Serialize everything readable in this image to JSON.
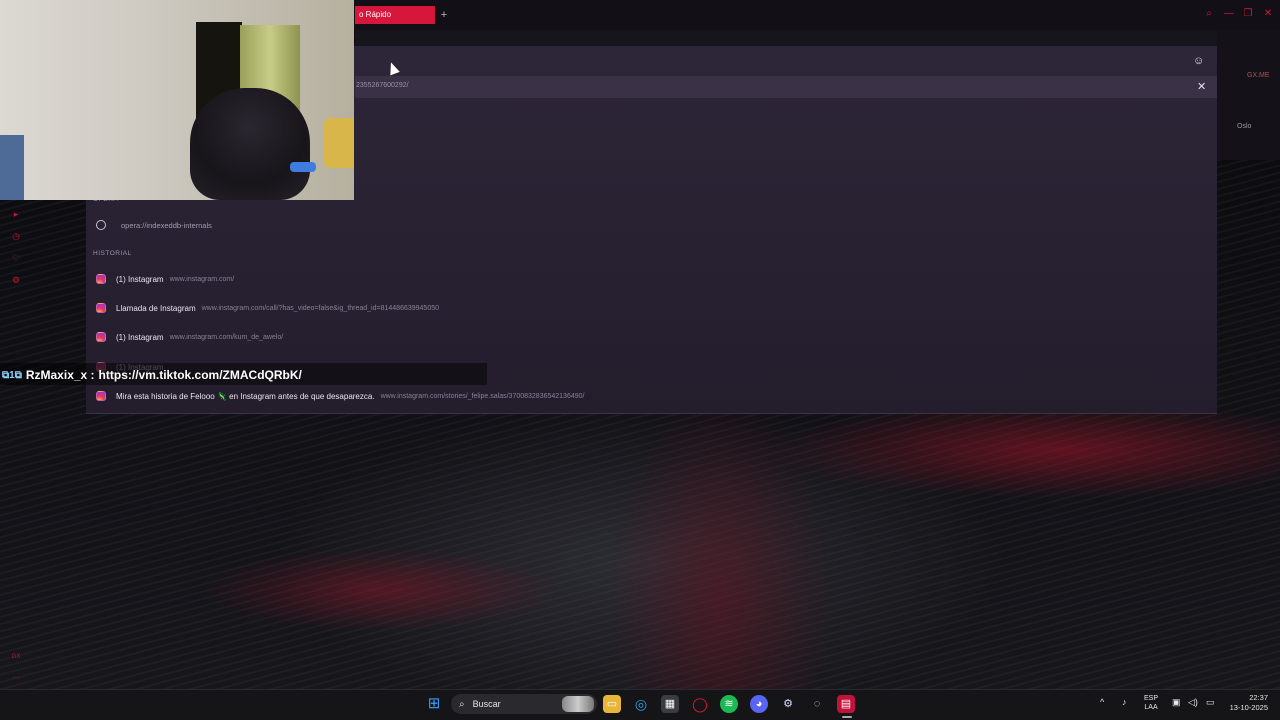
{
  "browser": {
    "active_tab_label": "o Rápido",
    "new_tab_glyph": "+",
    "window_controls": [
      "⌕",
      "—",
      "❐",
      "✕"
    ],
    "toolbar_icons": [
      "download-icon",
      "menu-icon",
      "wallet-icon"
    ],
    "right_sidebar_labels": [
      "GX.ME",
      "Oslo"
    ]
  },
  "dropdown": {
    "url_fragment": "2355267600292/",
    "emoji_icon": "☺",
    "close_glyph": "✕",
    "opera_section": "OPERA",
    "opera_items": [
      {
        "url": "opera://indexeddb-internals"
      }
    ],
    "history_section": "HISTORIAL",
    "history_items": [
      {
        "title": "(1) Instagram",
        "url": "www.instagram.com/"
      },
      {
        "title": "Llamada de Instagram",
        "url": "www.instagram.com/call/?has_video=false&ig_thread_id=814486639945050"
      },
      {
        "title": "(1) Instagram",
        "url": "www.instagram.com/kum_de_awelo/"
      },
      {
        "title": "(1) Instagram",
        "url": ""
      },
      {
        "title": "Mira esta historia de Felooo 🦎 en Instagram antes de que desaparezca.",
        "url": "www.instagram.com/stories/_felipe.salas/3700832836542136490/"
      }
    ]
  },
  "left_sidebar": {
    "icons": [
      "play-icon",
      "clock-icon",
      "heart-icon",
      "settings-icon"
    ],
    "bottom_labels": [
      "GX",
      "···"
    ]
  },
  "chat": {
    "badges": "⧉1⧉",
    "username": "RzMaxix_x :",
    "message": "https://vm.tiktok.com/ZMACdQRbK/"
  },
  "taskbar": {
    "search_label": "Buscar",
    "lang_line1": "ESP",
    "lang_line2": "LAA",
    "time": "22:37",
    "date": "13-10-2025"
  }
}
